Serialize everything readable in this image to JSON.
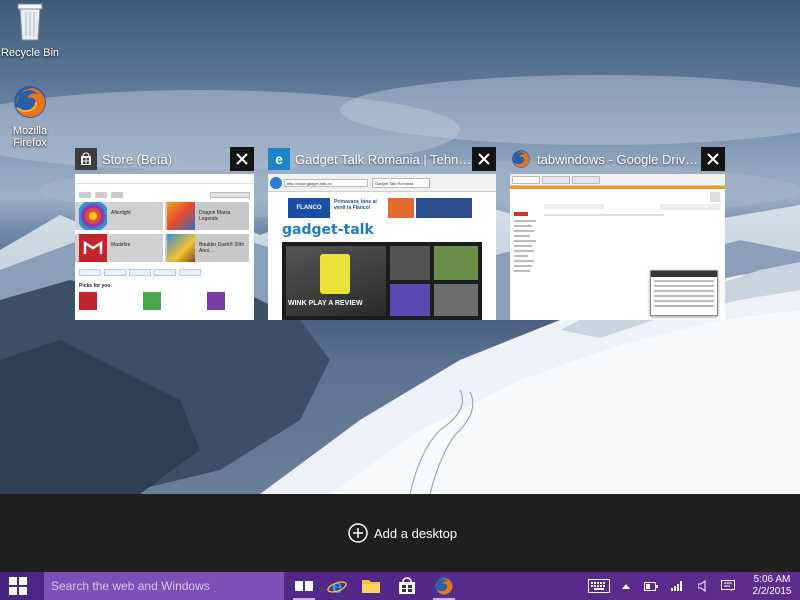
{
  "desktop": {
    "icons": [
      {
        "label": "Recycle Bin",
        "icon": "recycle-bin-icon"
      },
      {
        "label": "Mozilla Firefox",
        "icon": "firefox-icon"
      }
    ]
  },
  "task_view": {
    "windows": [
      {
        "title": "Store (Beta)",
        "app_icon": "store-icon",
        "thumbnail": {
          "apps": [
            "Afterlight",
            "Dragon Mania Legends",
            "Madefire",
            "Boulder Dash® 30th Anni..."
          ],
          "section_title": "Picks for you"
        }
      },
      {
        "title": "Gadget Talk Romania | Tehnologia...",
        "app_icon": "internet-explorer-icon",
        "thumbnail": {
          "address": "http://www.gadget-talk.ro/",
          "tab": "Gadget Talk Romania",
          "banner_text": "Primavara, bine ai venit la Flanco!",
          "banner_brand": "FLANCO",
          "logo": "gadget-talk",
          "headline": "WINK PLAY A REVIEW"
        }
      },
      {
        "title": "tabwindows - Google Drive -...",
        "app_icon": "firefox-icon",
        "thumbnail": {}
      }
    ],
    "add_desktop_label": "Add a desktop"
  },
  "taskbar": {
    "search_placeholder": "Search the web and Windows",
    "pinned": [
      "task-view-icon",
      "internet-explorer-icon",
      "file-explorer-icon",
      "store-icon",
      "firefox-icon"
    ],
    "clock": {
      "time": "5:06 AM",
      "date": "2/2/2015"
    }
  },
  "colors": {
    "taskbar": "#5a2a8a",
    "search_box": "#7e4fb6",
    "add_bar": "#1f1f1f",
    "close_button": "#141414"
  }
}
